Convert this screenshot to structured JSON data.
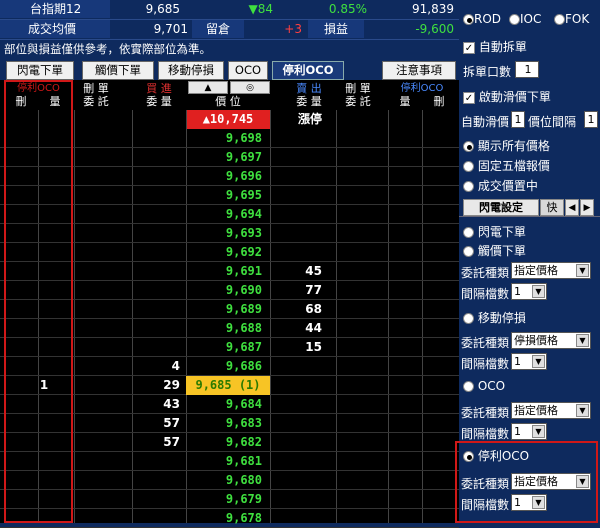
{
  "header": {
    "row1": {
      "label": "台指期12",
      "price": "9,685",
      "change": "▼84",
      "pct": "0.85%",
      "volume": "91,839"
    },
    "row2": {
      "label": "成交均價",
      "avg": "9,701",
      "pos_label": "留倉",
      "pos": "+3",
      "pl_label": "損益",
      "pl": "-9,600"
    }
  },
  "notice": "部位與損益僅供參考，依實際部位為準。",
  "tabs": [
    "閃電下單",
    "觸價下單",
    "移動停損",
    "OCO",
    "停利OCO"
  ],
  "notice_button": "注意事項",
  "ladder": {
    "left_group": "停利OCO",
    "left_cols": [
      "刪",
      "量"
    ],
    "buy_cols": {
      "delete": "刪 單",
      "entrust": "委 託",
      "buy_label": "買 進",
      "qty": "委 量"
    },
    "price_col": "價 位",
    "sell_cols": {
      "qty": "委 量",
      "sell_label": "賣 出",
      "delete": "刪 單",
      "entrust": "委 託"
    },
    "right_group": "停利OCO",
    "right_cols": [
      "量",
      "刪"
    ],
    "up_arrow": "▲",
    "center_btn": "◎",
    "limit_up": "▲10,745",
    "limit_up_label": "漲停",
    "rows": [
      {
        "price": "9,698",
        "bid": "",
        "ask": "",
        "lq": ""
      },
      {
        "price": "9,697",
        "bid": "",
        "ask": "",
        "lq": ""
      },
      {
        "price": "9,696",
        "bid": "",
        "ask": "",
        "lq": ""
      },
      {
        "price": "9,695",
        "bid": "",
        "ask": "",
        "lq": ""
      },
      {
        "price": "9,694",
        "bid": "",
        "ask": "",
        "lq": ""
      },
      {
        "price": "9,693",
        "bid": "",
        "ask": "",
        "lq": ""
      },
      {
        "price": "9,692",
        "bid": "",
        "ask": "",
        "lq": ""
      },
      {
        "price": "9,691",
        "bid": "",
        "ask": "45",
        "lq": ""
      },
      {
        "price": "9,690",
        "bid": "",
        "ask": "77",
        "lq": ""
      },
      {
        "price": "9,689",
        "bid": "",
        "ask": "68",
        "lq": ""
      },
      {
        "price": "9,688",
        "bid": "",
        "ask": "44",
        "lq": ""
      },
      {
        "price": "9,687",
        "bid": "",
        "ask": "15",
        "lq": ""
      },
      {
        "price": "9,686",
        "bid": "4",
        "ask": "",
        "lq": ""
      },
      {
        "price": "9,685 (1)",
        "bid": "29",
        "ask": "",
        "lq": "1",
        "current": true
      },
      {
        "price": "9,684",
        "bid": "43",
        "ask": "",
        "lq": ""
      },
      {
        "price": "9,683",
        "bid": "57",
        "ask": "",
        "lq": ""
      },
      {
        "price": "9,682",
        "bid": "57",
        "ask": "",
        "lq": ""
      },
      {
        "price": "9,681",
        "bid": "",
        "ask": "",
        "lq": ""
      },
      {
        "price": "9,680",
        "bid": "",
        "ask": "",
        "lq": ""
      },
      {
        "price": "9,679",
        "bid": "",
        "ask": "",
        "lq": ""
      },
      {
        "price": "9,678",
        "bid": "",
        "ask": "",
        "lq": ""
      }
    ]
  },
  "panel": {
    "order_types": [
      "ROD",
      "IOC",
      "FOK"
    ],
    "auto_split": "自動拆單",
    "split_qty_label": "拆單口數",
    "split_qty": "1",
    "slippage_label": "啟動滑價下單",
    "auto_slip_label": "自動滑價",
    "auto_slip": "1",
    "tick_gap_label": "價位間隔",
    "tick_gap": "1",
    "display_opts": [
      "顯示所有價格",
      "固定五檔報價",
      "成交價置中"
    ],
    "subtabs": [
      "閃電設定",
      "快"
    ],
    "sections": {
      "flash": "閃電下單",
      "touch": "觸價下單",
      "type_label": "委託種類",
      "gap_label": "間隔檔數",
      "type_limit": "指定價格",
      "type_stop": "停損價格",
      "gap_value": "1",
      "move": "移動停損",
      "oco": "OCO",
      "profit_oco": "停利OCO"
    }
  },
  "colors": {
    "bg": "#0e2a5e",
    "price": "#3fe03f",
    "current": "#f7c425",
    "limit": "#e02020",
    "highlight": "#d01818"
  }
}
